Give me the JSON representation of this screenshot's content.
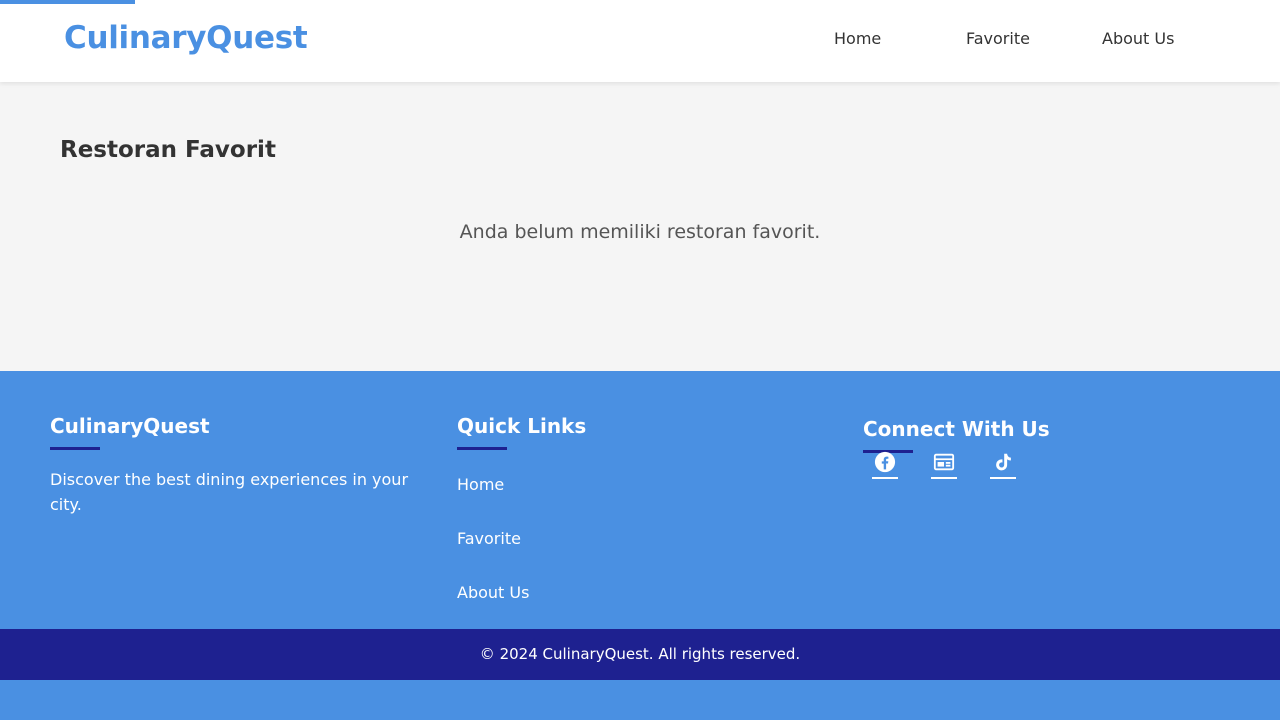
{
  "header": {
    "logo": "CulinaryQuest",
    "nav": [
      "Home",
      "Favorite",
      "About Us"
    ]
  },
  "main": {
    "title": "Restoran Favorit",
    "empty_message": "Anda belum memiliki restoran favorit."
  },
  "footer": {
    "about": {
      "title": "CulinaryQuest",
      "text": "Discover the best dining experiences in your city."
    },
    "quick_links": {
      "title": "Quick Links",
      "links": [
        "Home",
        "Favorite",
        "About Us"
      ]
    },
    "connect": {
      "title": "Connect With Us",
      "icons": [
        "facebook-icon",
        "news-icon",
        "tiktok-icon"
      ]
    },
    "copyright": "© 2024 CulinaryQuest. All rights reserved."
  },
  "colors": {
    "primary": "#4a90e2",
    "dark_blue": "#1e2190",
    "header_bg": "#ffffff",
    "main_bg": "#f5f5f5",
    "text_dark": "#333333"
  }
}
